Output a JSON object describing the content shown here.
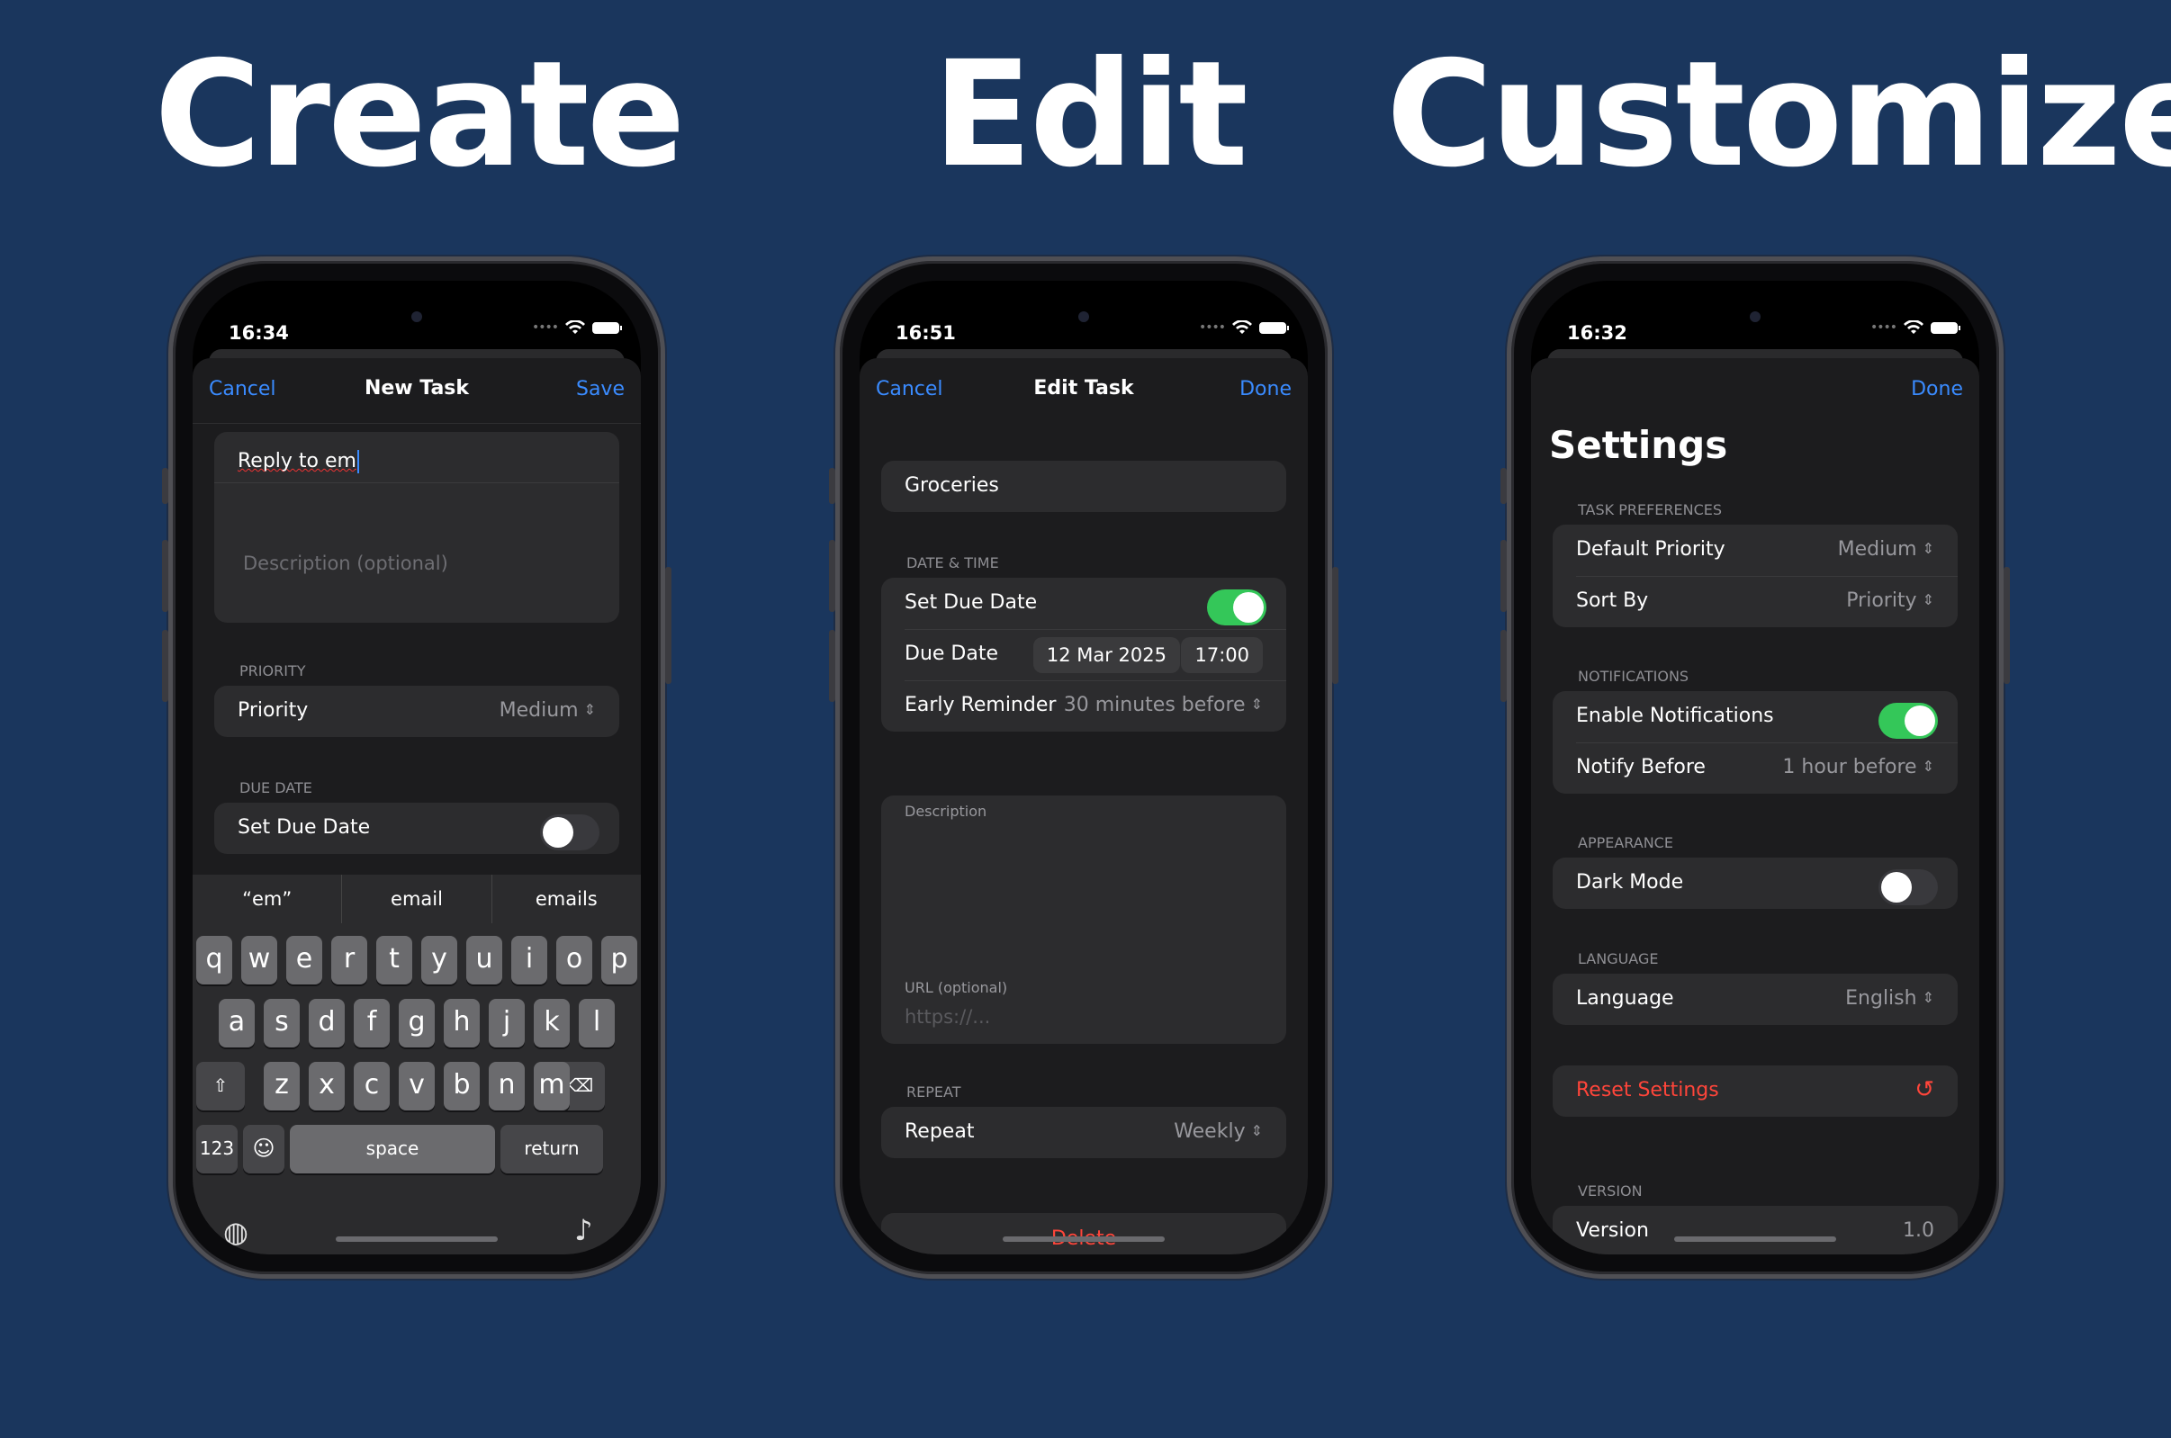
{
  "headlines": [
    "Create",
    "Edit",
    "Customize"
  ],
  "phone1": {
    "time": "16:34",
    "nav": {
      "left": "Cancel",
      "title": "New Task",
      "right": "Save"
    },
    "title_value": "Reply to em",
    "description_placeholder": "Description (optional)",
    "priority_section": "PRIORITY",
    "priority_label": "Priority",
    "priority_value": "Medium",
    "due_section": "DUE DATE",
    "due_label": "Set Due Date",
    "due_toggle_on": false,
    "suggestions": [
      "“em”",
      "email",
      "emails"
    ],
    "keys_row1": [
      "q",
      "w",
      "e",
      "r",
      "t",
      "y",
      "u",
      "i",
      "o",
      "p"
    ],
    "keys_row2": [
      "a",
      "s",
      "d",
      "f",
      "g",
      "h",
      "j",
      "k",
      "l"
    ],
    "keys_row3": [
      "z",
      "x",
      "c",
      "v",
      "b",
      "n",
      "m"
    ],
    "key_123": "123",
    "key_space": "space",
    "key_return": "return"
  },
  "phone2": {
    "time": "16:51",
    "nav": {
      "left": "Cancel",
      "title": "Edit Task",
      "right": "Done"
    },
    "title_value": "Groceries",
    "datetime_section": "DATE & TIME",
    "set_due_label": "Set Due Date",
    "set_due_on": true,
    "due_date_label": "Due Date",
    "due_date": "12 Mar 2025",
    "due_time": "17:00",
    "reminder_label": "Early Reminder",
    "reminder_value": "30 minutes before",
    "description_label": "Description",
    "url_label": "URL (optional)",
    "url_placeholder": "https://...",
    "repeat_section": "REPEAT",
    "repeat_label": "Repeat",
    "repeat_value": "Weekly",
    "delete_label": "Delete"
  },
  "phone3": {
    "time": "16:32",
    "nav_right": "Done",
    "title": "Settings",
    "task_section": "TASK PREFERENCES",
    "default_priority_label": "Default Priority",
    "default_priority_value": "Medium",
    "sort_label": "Sort By",
    "sort_value": "Priority",
    "notif_section": "NOTIFICATIONS",
    "enable_notif_label": "Enable Notifications",
    "enable_notif_on": true,
    "notify_before_label": "Notify Before",
    "notify_before_value": "1 hour before",
    "appearance_section": "APPEARANCE",
    "dark_mode_label": "Dark Mode",
    "dark_mode_on": false,
    "language_section": "LANGUAGE",
    "language_label": "Language",
    "language_value": "English",
    "reset_label": "Reset Settings",
    "version_section": "VERSION",
    "version_label": "Version",
    "version_value": "1.0"
  },
  "colors": {
    "background": "#1a365d",
    "accent": "#3a8bff",
    "toggle_on": "#34c759",
    "destructive": "#ff453a"
  }
}
